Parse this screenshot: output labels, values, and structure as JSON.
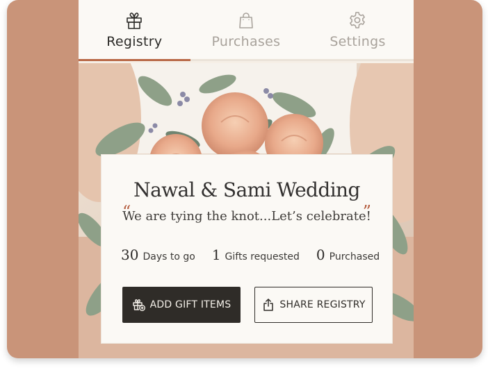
{
  "tabs": [
    {
      "label": "Registry",
      "icon": "gift-icon",
      "active": true
    },
    {
      "label": "Purchases",
      "icon": "shopping-bag-icon",
      "active": false
    },
    {
      "label": "Settings",
      "icon": "gear-icon",
      "active": false
    }
  ],
  "registry": {
    "title": "Nawal & Sami Wedding",
    "tagline": "We are tying the knot...Let’s celebrate!",
    "quote_open": "“",
    "quote_close": "”",
    "stats": [
      {
        "value": "30",
        "label": "Days to go"
      },
      {
        "value": "1",
        "label": "Gifts requested"
      },
      {
        "value": "0",
        "label": "Purchased"
      }
    ],
    "add_button": "ADD GIFT ITEMS",
    "share_button": "SHARE REGISTRY"
  },
  "colors": {
    "accent": "#b86745",
    "frame": "#c99479",
    "dark_button": "#2f2c28"
  }
}
